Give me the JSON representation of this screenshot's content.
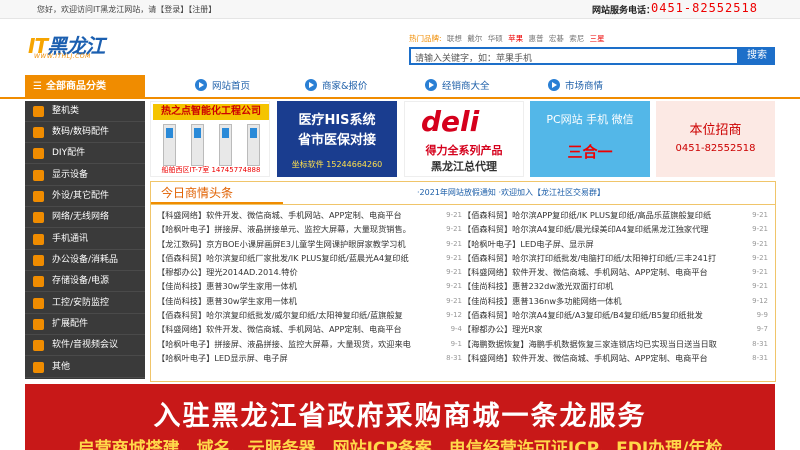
{
  "topbar": {
    "welcome_text": "您好，欢迎访问IT黑龙江网站，请",
    "login": "【登录】",
    "register": "【注册】",
    "hotline_label": "网站服务电话：",
    "hotline_number": "0451-82552518"
  },
  "logo": {
    "it": "IT",
    "name": "黑龙江",
    "domain": "WWW.ITHLJ.COM"
  },
  "search": {
    "hot_label": "热门品牌:",
    "hot_words": [
      "联想",
      "戴尔",
      "华硕",
      "苹果",
      "惠普",
      "宏碁",
      "索尼",
      "三星"
    ],
    "placeholder": "请输入关键字，如：苹果手机",
    "button": "搜索"
  },
  "nav": {
    "all_categories": "全部商品分类",
    "items": [
      "网站首页",
      "商家&报价",
      "经销商大全",
      "市场商情"
    ]
  },
  "sidebar": {
    "items": [
      "整机类",
      "数码/数码配件",
      "DIY配件",
      "显示设备",
      "外设/其它配件",
      "网络/无线网络",
      "手机通讯",
      "办公设备/消耗品",
      "存储设备/电源",
      "工控/安防监控",
      "扩展配件",
      "软件/音视频会议",
      "其他"
    ]
  },
  "ads": {
    "ad1_title": "热之点智能化工程公司",
    "ad1_footer": "船舶西区IT-7室 14745774888",
    "ad2_line1": "医疗HIS系统",
    "ad2_line2": "省市医保对接",
    "ad2_line3": "坐标软件 15244664260",
    "ad3_brand": "deli",
    "ad3_line1": "得力全系列产品",
    "ad3_line2": "黑龙江总代理",
    "ad4_line1": "PC网站 手机 微信",
    "ad4_line2": "三合一",
    "ad5_line1": "本位招商",
    "ad5_line2": "0451-82552518"
  },
  "news": {
    "title": "今日商情头条",
    "notice": "·2021年网站放假通知 ·欢迎加入【龙江社区交易群】",
    "left": [
      {
        "text": "【科盛网络】软件开发、微信商城、手机网站、APP定制、电商平台",
        "date": "9-21"
      },
      {
        "text": "【哈枫叶电子】拼接屏、液晶拼接单元、监控大屏幕，大量现货销售。",
        "date": "9-21"
      },
      {
        "text": "【龙江数码】京方BOE小课屏画屏E3儿童学生网课护眼屏家教学习机",
        "date": "9-21"
      },
      {
        "text": "【佰森科贸】哈尔滨复印纸厂家批发/IK PLUS复印纸/蓝晨光A4复印纸",
        "date": "9-21"
      },
      {
        "text": "【穆都办公】理光2014AD.2014.特价",
        "date": "9-21"
      },
      {
        "text": "【佳尚科技】惠普30w学生家用一体机",
        "date": "9-21"
      },
      {
        "text": "【佳尚科技】惠普30w学生家用一体机",
        "date": "9-21"
      },
      {
        "text": "【佰森科贸】哈尔滨复印纸批发/威尔复印纸/太阳神复印纸/蓝旗般复",
        "date": "9-12"
      },
      {
        "text": "【科盛网络】软件开发、微信商城、手机网站、APP定制、电商平台",
        "date": "9-4"
      },
      {
        "text": "【哈枫叶电子】拼接屏、液晶拼接、监控大屏幕，大量现货，欢迎来电",
        "date": "9-1"
      },
      {
        "text": "【哈枫叶电子】LED显示屏、电子屏",
        "date": "8-31"
      }
    ],
    "right": [
      {
        "text": "【佰森科贸】哈尔滨APP复印纸/IK PLUS复印纸/高品乐蓝旗般复印纸",
        "date": "9-21"
      },
      {
        "text": "【佰森科贸】哈尔滨A4复印纸/晨光绿美印A4复印纸黑龙江独家代理",
        "date": "9-21"
      },
      {
        "text": "【哈枫叶电子】LED电子屏、显示屏",
        "date": "9-21"
      },
      {
        "text": "【佰森科贸】哈尔滨打印纸批发/电脑打印纸/太阳神打印纸/三丰241打",
        "date": "9-21"
      },
      {
        "text": "【科盛网络】软件开发、微信商城、手机网站、APP定制、电商平台",
        "date": "9-21"
      },
      {
        "text": "【佳尚科技】惠普232dw激光双面打印机",
        "date": "9-21"
      },
      {
        "text": "【佳尚科技】惠普136nw多功能网络一体机",
        "date": "9-12"
      },
      {
        "text": "【佰森科贸】哈尔滨A4复印纸/A3复印纸/B4复印纸/B5复印纸批发",
        "date": "9-9"
      },
      {
        "text": "【穆都办公】理光R家",
        "date": "9-7"
      },
      {
        "text": "【海鹏数据恢复】海鹏手机数据恢复三家连锁店均已实现当日送当日取",
        "date": "8-31"
      },
      {
        "text": "【科盛网络】软件开发、微信商城、手机网站、APP定制、电商平台",
        "date": "8-31"
      }
    ]
  },
  "bottom_banner": {
    "line1": "入驻黑龙江省政府采购商城一条龙服务",
    "line2": "启营商城搭建、域名、云服务器、网站ICP备案、电信经营许可证ICP、EDI办理/年检"
  }
}
